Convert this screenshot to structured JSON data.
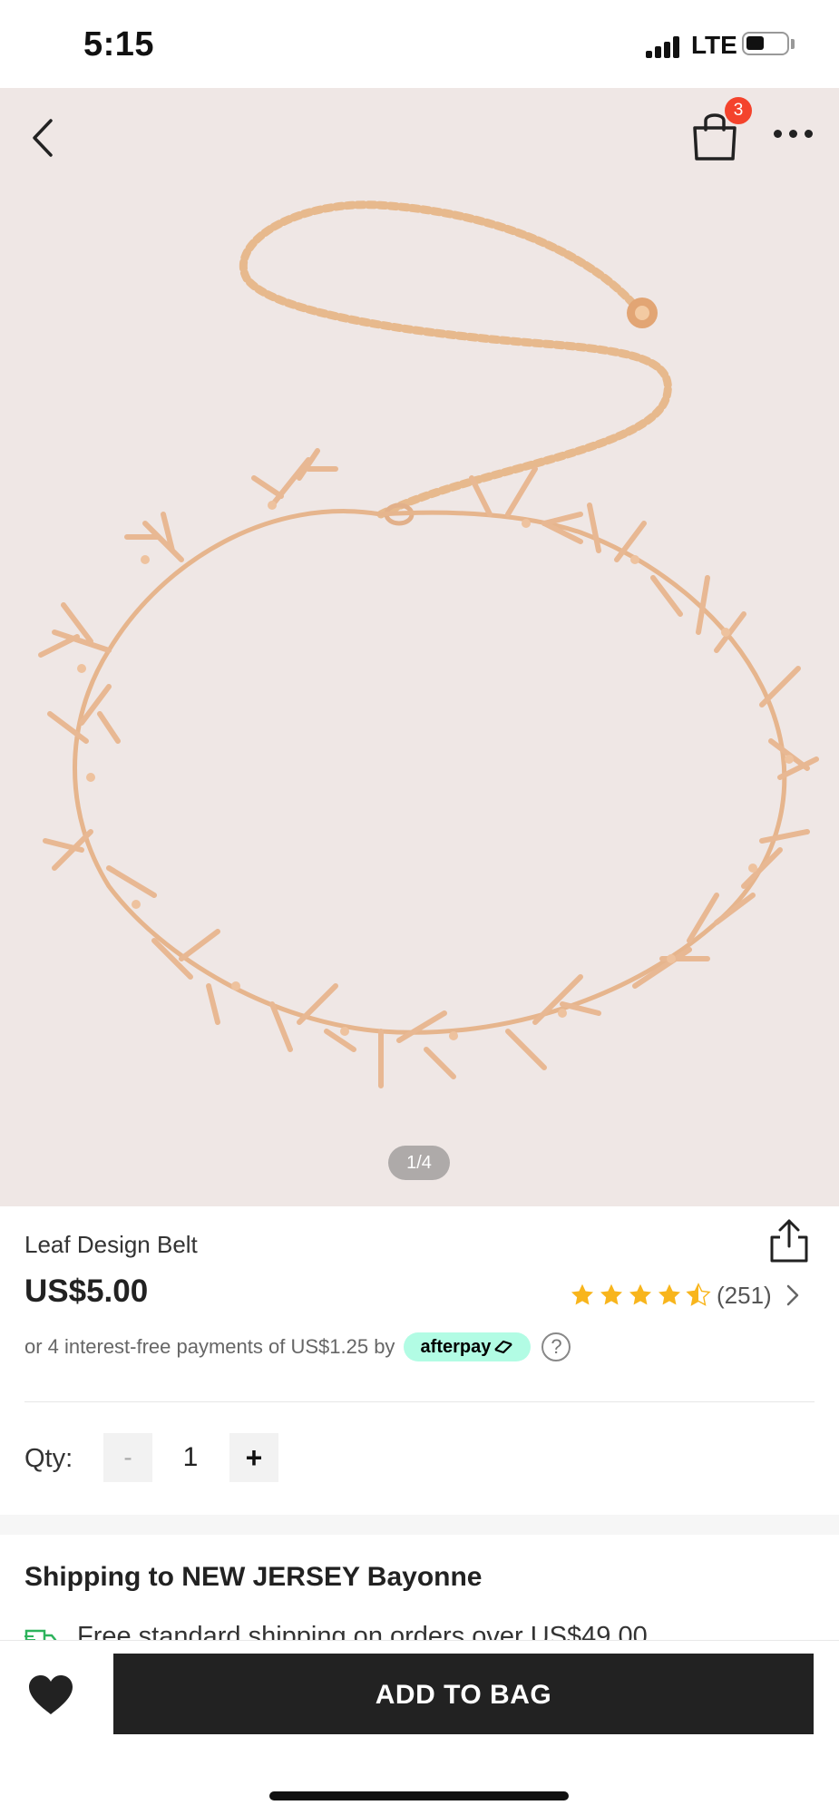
{
  "status_bar": {
    "time": "5:15",
    "network": "LTE",
    "battery_level": 0.4
  },
  "gallery": {
    "cart_count": "3",
    "page_indicator": "1/4",
    "background": "#efe7e5"
  },
  "product": {
    "title": "Leaf Design Belt",
    "price": "US$5.00",
    "rating": 4.5,
    "rating_count": "(251)",
    "afterpay_text": "or 4 interest-free payments of US$1.25 by",
    "afterpay_label": "afterpay",
    "help_label": "?"
  },
  "quantity": {
    "label": "Qty:",
    "minus": "-",
    "value": "1",
    "plus": "+"
  },
  "shipping": {
    "title": "Shipping to NEW JERSEY Bayonne",
    "free_shipping_text": "Free standard shipping on orders over US$49.00"
  },
  "actions": {
    "add_to_bag_label": "ADD TO BAG"
  },
  "colors": {
    "accent": "#222222",
    "badge": "#f4432c",
    "star": "#f8b51c",
    "afterpay": "#b2fce4",
    "truck": "#2db35c"
  },
  "icons": [
    "back-arrow-icon",
    "shopping-bag-icon",
    "more-dots-icon",
    "share-icon",
    "star-icon",
    "chevron-right-icon",
    "help-icon",
    "truck-icon",
    "heart-icon"
  ]
}
